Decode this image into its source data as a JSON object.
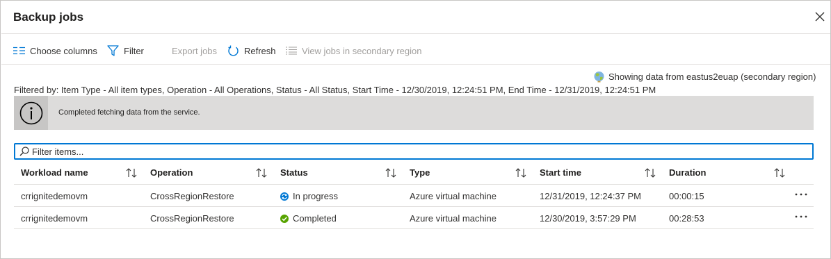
{
  "blade": {
    "title": "Backup jobs",
    "close_icon": "close-icon"
  },
  "toolbar": {
    "choose_columns": "Choose columns",
    "filter": "Filter",
    "export_jobs": "Export jobs",
    "refresh": "Refresh",
    "view_secondary": "View jobs in secondary region"
  },
  "region_note": "Showing data from eastus2euap (secondary region)",
  "filter_summary": "Filtered by: Item Type - All item types, Operation - All Operations, Status - All Status, Start Time - 12/30/2019, 12:24:51 PM, End Time - 12/31/2019, 12:24:51 PM",
  "info_message": "Completed fetching data from the service.",
  "search": {
    "placeholder": "Filter items..."
  },
  "table": {
    "columns": [
      "Workload name",
      "Operation",
      "Status",
      "Type",
      "Start time",
      "Duration"
    ],
    "rows": [
      {
        "workload": "crrignitedemovm",
        "operation": "CrossRegionRestore",
        "status": "In progress",
        "type": "Azure virtual machine",
        "start": "12/31/2019, 12:24:37 PM",
        "duration": "00:00:15"
      },
      {
        "workload": "crrignitedemovm",
        "operation": "CrossRegionRestore",
        "status": "Completed",
        "type": "Azure virtual machine",
        "start": "12/30/2019, 3:57:29 PM",
        "duration": "00:28:53"
      }
    ]
  },
  "colors": {
    "accent": "#0078d4",
    "success": "#57a300",
    "info_bar": "#dddcdb"
  }
}
